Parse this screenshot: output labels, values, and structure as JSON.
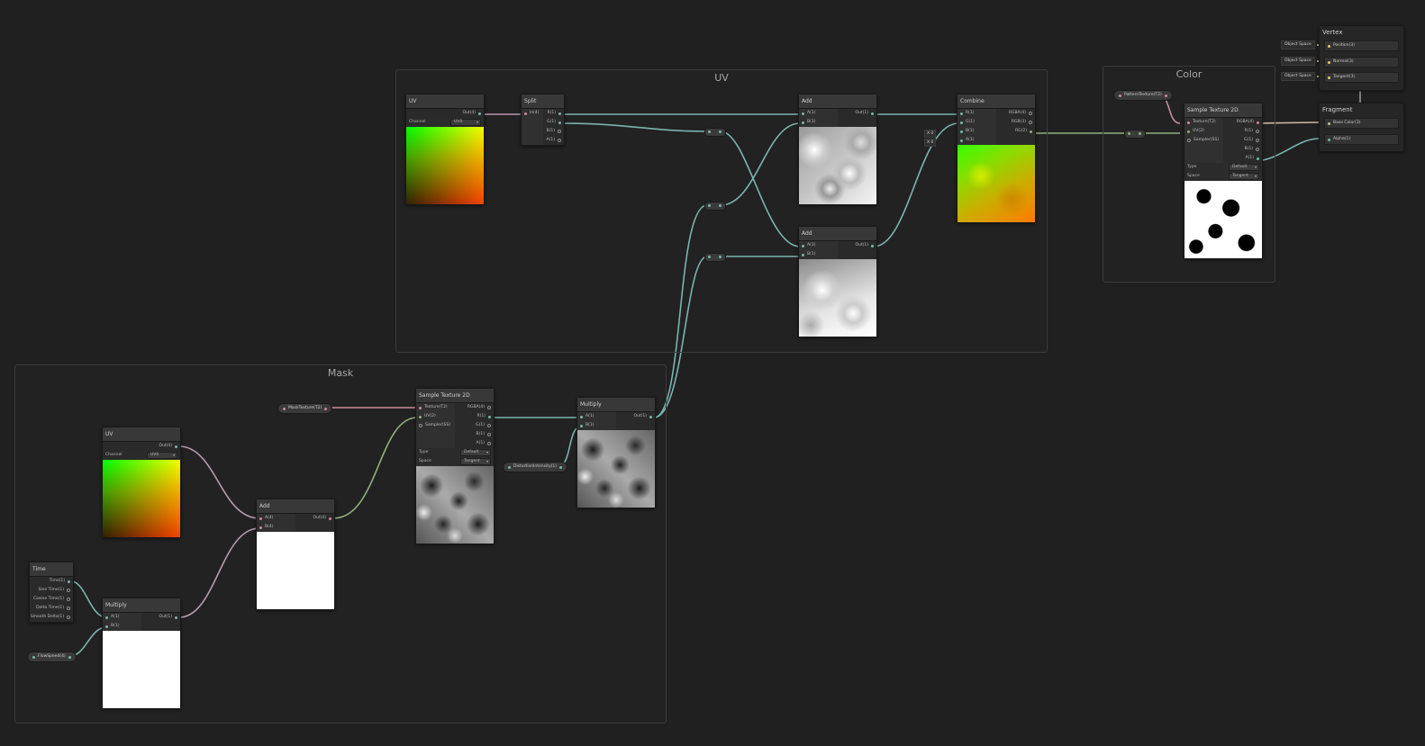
{
  "groups": {
    "uv": "UV",
    "color": "Color",
    "mask": "Mask"
  },
  "nodes": {
    "uv_top": {
      "title": "UV",
      "out": "Out(4)",
      "channel_label": "Channel",
      "channel_value": "UV0"
    },
    "split": {
      "title": "Split",
      "in": "In(4)",
      "outs": [
        "R(1)",
        "G(1)",
        "B(1)",
        "A(1)"
      ]
    },
    "add_top": {
      "title": "Add",
      "ins": [
        "A(1)",
        "B(1)"
      ],
      "out": "Out(1)"
    },
    "add_mid": {
      "title": "Add",
      "ins": [
        "A(1)",
        "B(1)"
      ],
      "out": "Out(1)"
    },
    "combine": {
      "title": "Combine",
      "ins": [
        "R(1)",
        "G(1)",
        "B(1)",
        "A(1)"
      ],
      "outs": [
        "RGBA(4)",
        "RGB(3)",
        "RG(2)"
      ],
      "fields": [
        "X",
        "0",
        "X",
        "0"
      ]
    },
    "sample_color": {
      "title": "Sample Texture 2D",
      "ins": [
        "Texture(T2)",
        "UV(2)",
        "Sampler(SS)"
      ],
      "outs": [
        "RGBA(4)",
        "R(1)",
        "G(1)",
        "B(1)",
        "A(1)"
      ],
      "type_label": "Type",
      "type_value": "Default",
      "space_label": "Space",
      "space_value": "Tangent"
    },
    "sample_mask": {
      "title": "Sample Texture 2D",
      "ins": [
        "Texture(T2)",
        "UV(2)",
        "Sampler(SS)"
      ],
      "outs": [
        "RGBA(4)",
        "R(1)",
        "G(1)",
        "B(1)",
        "A(1)"
      ],
      "type_label": "Type",
      "type_value": "Default",
      "space_label": "Space",
      "space_value": "Tangent"
    },
    "multiply_mask": {
      "title": "Multiply",
      "ins": [
        "A(1)",
        "B(1)"
      ],
      "out": "Out(1)"
    },
    "uv_bottom": {
      "title": "UV",
      "out": "Out(4)",
      "channel_label": "Channel",
      "channel_value": "UV0"
    },
    "add_bottom": {
      "title": "Add",
      "ins": [
        "A(4)",
        "B(4)"
      ],
      "out": "Out(4)"
    },
    "time": {
      "title": "Time",
      "outs": [
        "Time(1)",
        "Sine Time(1)",
        "Cosine Time(1)",
        "Delta Time(1)",
        "Smooth Delta(1)"
      ]
    },
    "multiply_bottom": {
      "title": "Multiply",
      "ins": [
        "A(1)",
        "B(1)"
      ],
      "out": "Out(1)"
    }
  },
  "properties": {
    "pattern_texture": "PatternTexture(T2)",
    "mask_texture": "MaskTexture(T2)",
    "distortion_intensity": "DistortionIntensity(1)",
    "flow_speed": "FlowSpeed(4)"
  },
  "vertex": {
    "title": "Vertex",
    "rows": [
      {
        "space": "Object Space",
        "label": "Position(3)"
      },
      {
        "space": "Object Space",
        "label": "Normal(3)"
      },
      {
        "space": "Object Space",
        "label": "Tangent(3)"
      }
    ]
  },
  "fragment": {
    "title": "Fragment",
    "rows": [
      "Base Color(3)",
      "Alpha(1)"
    ]
  },
  "colors": {
    "background": "#202020",
    "wire_float": "#7ab4b0",
    "wire_texture": "#c98b9a",
    "wire_vector": "#8fb07a",
    "wire_uv": "#b89ab0"
  }
}
